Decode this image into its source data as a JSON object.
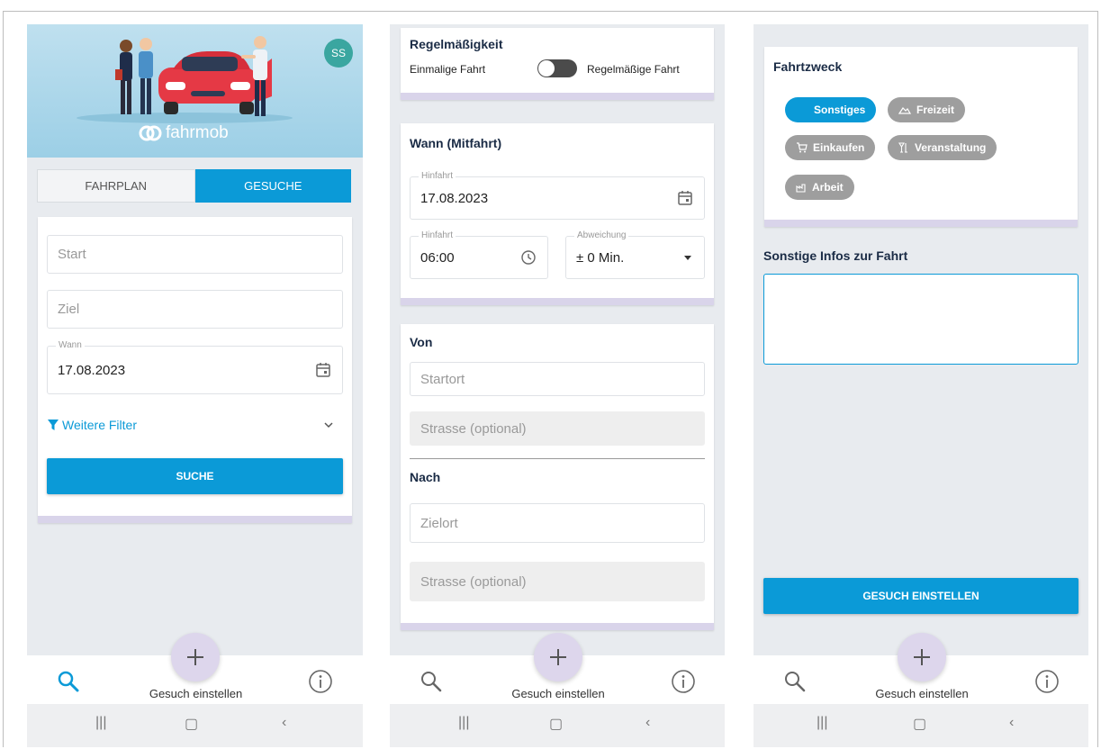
{
  "screen1": {
    "avatar_initials": "SS",
    "logo_text": "fahrmob",
    "tabs": [
      {
        "label": "FAHRPLAN",
        "active": false
      },
      {
        "label": "GESUCHE",
        "active": true
      }
    ],
    "start_placeholder": "Start",
    "ziel_placeholder": "Ziel",
    "wann_label": "Wann",
    "wann_value": "17.08.2023",
    "filter_label": "Weitere Filter",
    "search_button": "SUCHE"
  },
  "screen2": {
    "regularity_title": "Regelmäßigkeit",
    "option_once": "Einmalige Fahrt",
    "option_regular": "Regelmäßige Fahrt",
    "when_title": "Wann (Mitfahrt)",
    "date_label": "Hinfahrt",
    "date_value": "17.08.2023",
    "time_label": "Hinfahrt",
    "time_value": "06:00",
    "deviation_label": "Abweichung",
    "deviation_value": "± 0 Min.",
    "from_title": "Von",
    "from_placeholder": "Startort",
    "from_street_placeholder": "Strasse (optional)",
    "to_title": "Nach",
    "to_placeholder": "Zielort",
    "to_street_placeholder": "Strasse (optional)"
  },
  "screen3": {
    "purpose_title": "Fahrtzweck",
    "chips": [
      "Sonstiges",
      "Freizeit",
      "Einkaufen",
      "Veranstaltung",
      "Arbeit"
    ],
    "info_title": "Sonstige Infos zur Fahrt",
    "submit_button": "GESUCH EINSTELLEN"
  },
  "nav": {
    "fab_label": "Gesuch einstellen",
    "search_icon_color_active": "#0b9ad7",
    "search_icon_color_inactive": "#666666"
  },
  "colors": {
    "primary": "#0b9ad7",
    "card_accent": "#d9d4ea",
    "fab_bg": "#ddd6ec",
    "chip_unselected": "#9e9e9e"
  }
}
